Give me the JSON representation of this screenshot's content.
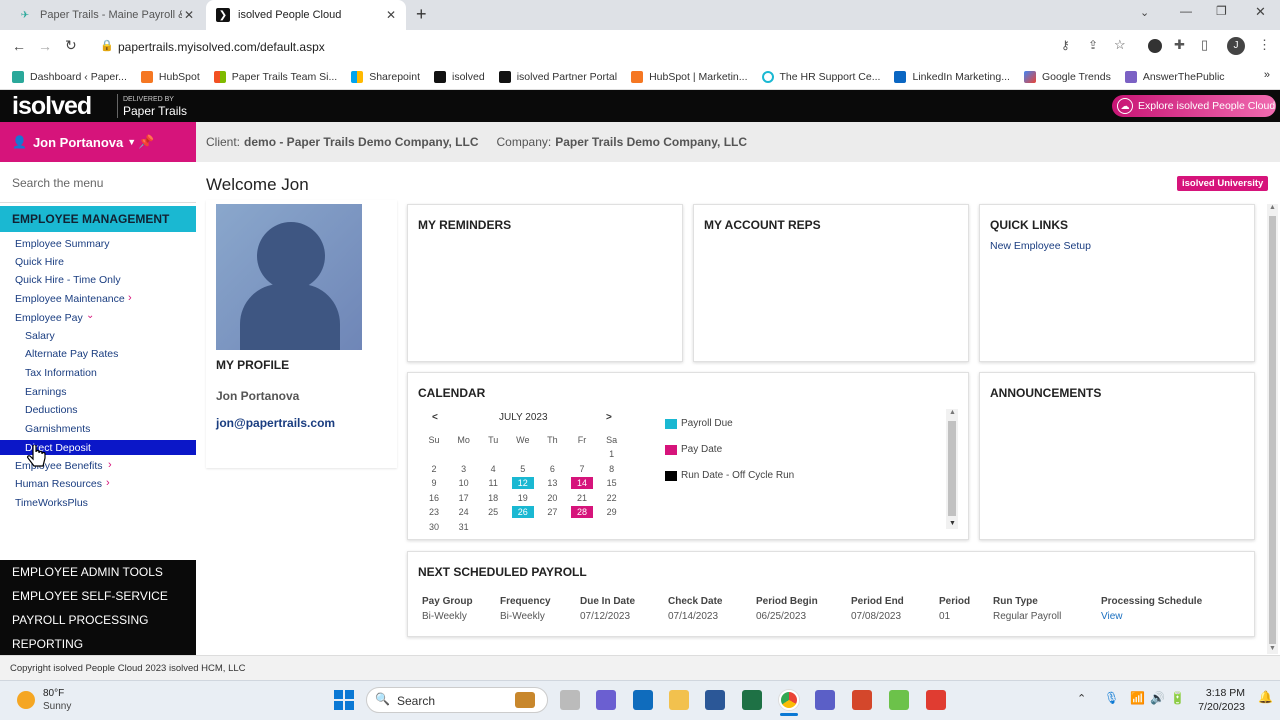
{
  "browser": {
    "tabs": [
      {
        "title": "Paper Trails - Maine Payroll & Bo",
        "active": false
      },
      {
        "title": "isolved People Cloud",
        "active": true
      }
    ],
    "new_tab": "+",
    "url": "papertrails.myisolved.com/default.aspx",
    "profile_initial": "J",
    "bookmarks": [
      "Dashboard ‹ Paper...",
      "HubSpot",
      "Paper Trails Team Si...",
      "Sharepoint",
      "isolved",
      "isolved Partner Portal",
      "HubSpot | Marketin...",
      "The HR Support Ce...",
      "LinkedIn Marketing...",
      "Google Trends",
      "AnswerThePublic"
    ]
  },
  "app": {
    "logo": "isolved",
    "delivered_by": "DELIVERED BY",
    "delivered_company": "Paper Trails",
    "explore_label": "Explore isolved People Cloud",
    "user_name": "Jon Portanova",
    "client_label": "Client:",
    "client_value": "demo - Paper Trails Demo Company, LLC",
    "company_label": "Company:",
    "company_value": "Paper Trails Demo Company, LLC",
    "university_label": "isolved University"
  },
  "sidebar": {
    "search_placeholder": "Search the menu",
    "section_title": "EMPLOYEE MANAGEMENT",
    "items": {
      "employee_summary": "Employee Summary",
      "quick_hire": "Quick Hire",
      "quick_hire_time": "Quick Hire - Time Only",
      "employee_maintenance": "Employee Maintenance",
      "employee_pay": "Employee Pay",
      "salary": "Salary",
      "alternate_pay_rates": "Alternate Pay Rates",
      "tax_information": "Tax Information",
      "earnings": "Earnings",
      "deductions": "Deductions",
      "garnishments": "Garnishments",
      "direct_deposit": "Direct Deposit",
      "employee_benefits": "Employee Benefits",
      "human_resources": "Human Resources",
      "timeworksplus": "TimeWorksPlus"
    },
    "dark_menu": [
      "EMPLOYEE ADMIN TOOLS",
      "EMPLOYEE SELF-SERVICE",
      "PAYROLL PROCESSING",
      "REPORTING"
    ]
  },
  "main": {
    "welcome": "Welcome Jon",
    "profile": {
      "title": "MY PROFILE",
      "name": "Jon Portanova",
      "email": "jon@papertrails.com"
    },
    "reminders_title": "MY REMINDERS",
    "account_reps_title": "MY ACCOUNT REPS",
    "quick_links": {
      "title": "QUICK LINKS",
      "link": "New Employee Setup"
    },
    "announcements_title": "ANNOUNCEMENTS",
    "calendar": {
      "title": "CALENDAR",
      "month": "JULY 2023",
      "prev": "<",
      "next": ">",
      "weekdays": [
        "Su",
        "Mo",
        "Tu",
        "We",
        "Th",
        "Fr",
        "Sa"
      ],
      "weeks": [
        [
          "",
          "",
          "",
          "",
          "",
          "",
          "1"
        ],
        [
          "2",
          "3",
          "4",
          "5",
          "6",
          "7",
          "8"
        ],
        [
          "9",
          "10",
          "11",
          "12",
          "13",
          "14",
          "15"
        ],
        [
          "16",
          "17",
          "18",
          "19",
          "20",
          "21",
          "22"
        ],
        [
          "23",
          "24",
          "25",
          "26",
          "27",
          "28",
          "29"
        ],
        [
          "30",
          "31",
          "",
          "",
          "",
          "",
          ""
        ]
      ],
      "payroll_due_days": [
        "12",
        "26"
      ],
      "pay_days": [
        "14",
        "28"
      ],
      "legend": [
        {
          "label": "Payroll Due",
          "color": "#1ab8d2"
        },
        {
          "label": "Pay Date",
          "color": "#d6147b"
        },
        {
          "label": "Run Date - Off Cycle Run",
          "color": "#000000"
        }
      ]
    },
    "next_payroll": {
      "title": "NEXT SCHEDULED PAYROLL",
      "headers": [
        "Pay Group",
        "Frequency",
        "Due In Date",
        "Check Date",
        "Period Begin",
        "Period End",
        "Period",
        "Run Type",
        "Processing Schedule"
      ],
      "row": [
        "Bi-Weekly",
        "Bi-Weekly",
        "07/12/2023",
        "07/14/2023",
        "06/25/2023",
        "07/08/2023",
        "01",
        "Regular Payroll",
        "View"
      ]
    }
  },
  "footer": "Copyright isolved People Cloud 2023 isolved HCM, LLC",
  "taskbar": {
    "temp": "80°F",
    "weather": "Sunny",
    "search": "Search",
    "time": "3:18 PM",
    "date": "7/20/2023"
  },
  "colors": {
    "accent_pink": "#d6147b",
    "accent_cyan": "#1ab8d2",
    "nav_blue": "#0b17c8"
  }
}
